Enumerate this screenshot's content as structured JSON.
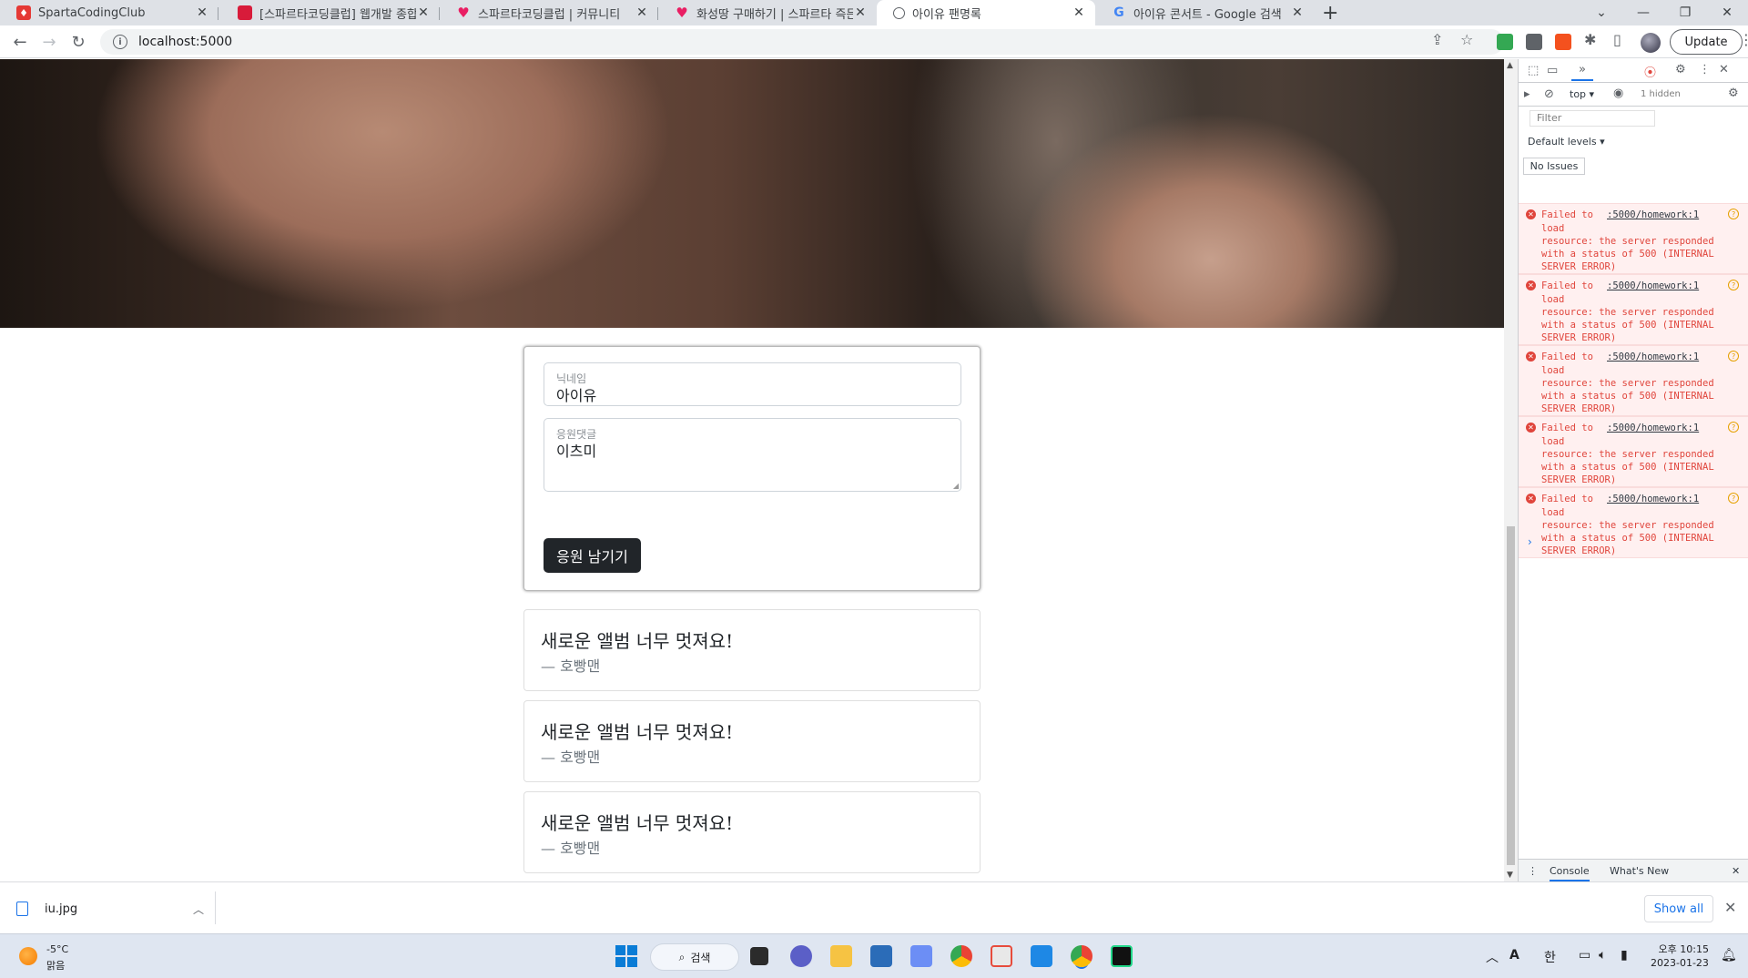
{
  "browser": {
    "tabs": [
      {
        "title": "SpartaCodingClub",
        "favicon_color": "#e53935",
        "active": false
      },
      {
        "title": "[스파르타코딩클럽] 웹개발 종합",
        "favicon_color": "#d81b3a",
        "active": false
      },
      {
        "title": "스파르타코딩클럽 | 커뮤니티",
        "favicon_color": "#e91e63",
        "active": false
      },
      {
        "title": "화성땅 구매하기 | 스파르타 즉든",
        "favicon_color": "#e91e63",
        "active": false
      },
      {
        "title": "아이유 팬명록",
        "favicon_color": "#5f6368",
        "active": true
      },
      {
        "title": "아이유 콘서트 - Google 검색",
        "favicon_color": "#4285f4",
        "active": false
      }
    ],
    "new_tab_glyph": "+",
    "window_controls": {
      "dropdown": "⌄",
      "minimize": "—",
      "restore": "❐",
      "close": "✕"
    },
    "toolbar": {
      "url": "localhost:5000",
      "update_label": "Update"
    }
  },
  "page": {
    "form": {
      "nickname_label": "닉네임",
      "nickname_value": "아이유",
      "comment_label": "응원댓글",
      "comment_value": "이츠미",
      "submit_label": "응원 남기기"
    },
    "comments": [
      {
        "text": "새로운 앨범 너무 멋져요!",
        "author": "— 호빵맨"
      },
      {
        "text": "새로운 앨범 너무 멋져요!",
        "author": "— 호빵맨"
      },
      {
        "text": "새로운 앨범 너무 멋져요!",
        "author": "— 호빵맨"
      }
    ]
  },
  "devtools": {
    "context": "top",
    "hidden_count": "1 hidden",
    "filter_placeholder": "Filter",
    "levels_label": "Default levels",
    "issues_label": "No Issues",
    "errors": [
      {
        "prefix": "Failed to",
        "link": ":5000/homework:1",
        "body": "load\nresource: the server responded\nwith a status of 500 (INTERNAL\nSERVER ERROR)"
      },
      {
        "prefix": "Failed to",
        "link": ":5000/homework:1",
        "body": "load\nresource: the server responded\nwith a status of 500 (INTERNAL\nSERVER ERROR)"
      },
      {
        "prefix": "Failed to",
        "link": ":5000/homework:1",
        "body": "load\nresource: the server responded\nwith a status of 500 (INTERNAL\nSERVER ERROR)"
      },
      {
        "prefix": "Failed to",
        "link": ":5000/homework:1",
        "body": "load\nresource: the server responded\nwith a status of 500 (INTERNAL\nSERVER ERROR)"
      },
      {
        "prefix": "Failed to",
        "link": ":5000/homework:1",
        "body": "load\nresource: the server responded\nwith a status of 500 (INTERNAL\nSERVER ERROR)"
      }
    ],
    "bottom_tabs": {
      "console": "Console",
      "whats_new": "What's New"
    }
  },
  "downloads": {
    "file_name": "iu.jpg",
    "show_all_label": "Show all"
  },
  "taskbar": {
    "weather_temp": "-5°C",
    "weather_desc": "맑음",
    "search_label": "검색",
    "tray_font": "A",
    "tray_ime": "한",
    "clock_time": "오후 10:15",
    "clock_date": "2023-01-23"
  }
}
